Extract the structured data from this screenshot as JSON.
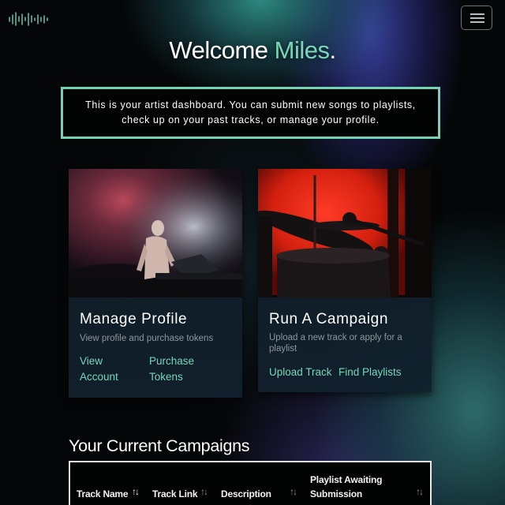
{
  "nav": {
    "logo_icon": "soundwave-logo",
    "menu_icon": "hamburger-icon"
  },
  "welcome": {
    "greeting": "Welcome ",
    "name": "Miles",
    "punctuation": "."
  },
  "intro": {
    "text": "This is your artist dashboard. You can submit new songs to playlists, check up on your past tracks, or manage your profile."
  },
  "cards": {
    "profile": {
      "title": "Manage Profile",
      "subtitle": "View profile and purchase tokens",
      "link1_line1": "View",
      "link1_line2": "Account",
      "link2_line1": "Purchase",
      "link2_line2": "Tokens"
    },
    "campaign": {
      "title": "Run A Campaign",
      "subtitle": "Upload a new track or apply for a playlist",
      "link1": "Upload Track",
      "link2": "Find Playlists"
    }
  },
  "campaigns": {
    "title": "Your Current Campaigns",
    "columns": [
      "Track Name",
      "Track Link",
      "Description",
      "Playlist Awaiting Submission"
    ],
    "col4_line1": "Playlist Awaiting",
    "col4_line2": "Submission"
  },
  "colors": {
    "accent": "#78d4b7",
    "border": "#6fd3b4",
    "background": "#050607"
  }
}
